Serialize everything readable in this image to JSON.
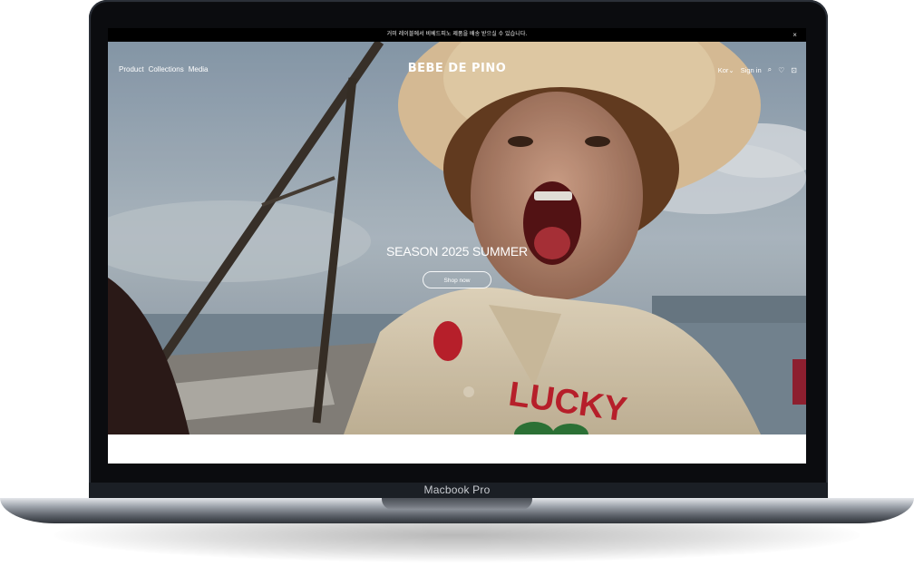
{
  "device": {
    "label": "Macbook Pro"
  },
  "announcement": {
    "text": "거미 레이블에서 비베드피노 제품을 배송 받으실 수 있습니다.",
    "close_icon": "close-icon",
    "close_glyph": "×"
  },
  "nav": {
    "left": [
      "Product",
      "Collections",
      "Media"
    ],
    "logo": "BEBE DE PINO",
    "lang": "Kor",
    "lang_caret": "⌄",
    "signin": "Sign in",
    "icons": [
      "search-icon",
      "heart-icon",
      "bag-icon"
    ],
    "icon_glyphs": [
      "⌕",
      "♡",
      "⊡"
    ]
  },
  "hero": {
    "title": "SEASON 2025 SUMMER",
    "button": "Shop now",
    "shirt_text": "LUCKY"
  },
  "colors": {
    "bezel": "#0b0c0f",
    "chin": "#1b1f25",
    "accent_red": "#c6222e"
  }
}
